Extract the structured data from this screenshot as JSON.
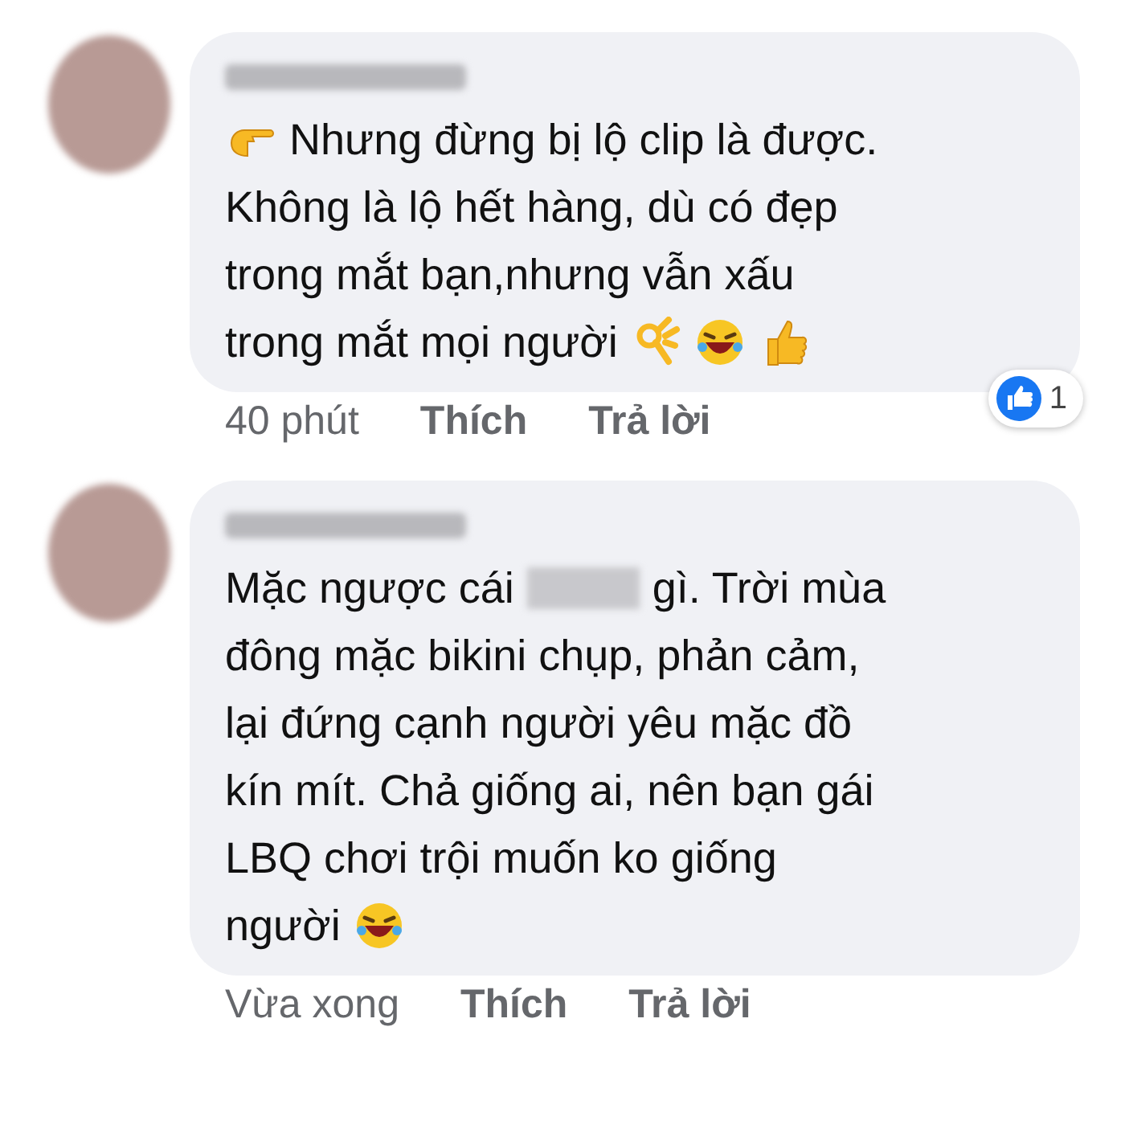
{
  "comments": [
    {
      "lines": [
        [
          {
            "kind": "point-icon"
          },
          {
            "kind": "text",
            "text": "Nhưng đừng bị lộ clip là được."
          }
        ],
        [
          {
            "kind": "text",
            "text": "Không là lộ hết hàng, dù có đẹp"
          }
        ],
        [
          {
            "kind": "text",
            "text": "trong mắt bạn,nhưng vẫn xấu"
          }
        ],
        [
          {
            "kind": "text",
            "text": "trong mắt mọi người"
          },
          {
            "kind": "ok-icon"
          },
          {
            "kind": "laugh-icon"
          },
          {
            "kind": "thumb-icon"
          }
        ]
      ],
      "time": "40 phút",
      "like": "Thích",
      "reply": "Trả lời",
      "reactions": {
        "count": "1"
      }
    },
    {
      "lines": [
        [
          {
            "kind": "text",
            "text": "Mặc ngược cái"
          },
          {
            "kind": "censored"
          },
          {
            "kind": "text",
            "text": "gì. Trời mùa"
          }
        ],
        [
          {
            "kind": "text",
            "text": "đông mặc bikini chụp, phản cảm,"
          }
        ],
        [
          {
            "kind": "text",
            "text": "lại đứng cạnh người yêu mặc đồ"
          }
        ],
        [
          {
            "kind": "text",
            "text": "kín mít. Chả giống ai, nên bạn gái"
          }
        ],
        [
          {
            "kind": "text",
            "text": "LBQ chơi trội muốn ko giống"
          }
        ],
        [
          {
            "kind": "text",
            "text": "người"
          },
          {
            "kind": "laugh-icon"
          }
        ]
      ],
      "time": "Vừa xong",
      "like": "Thích",
      "reply": "Trả lời"
    }
  ]
}
